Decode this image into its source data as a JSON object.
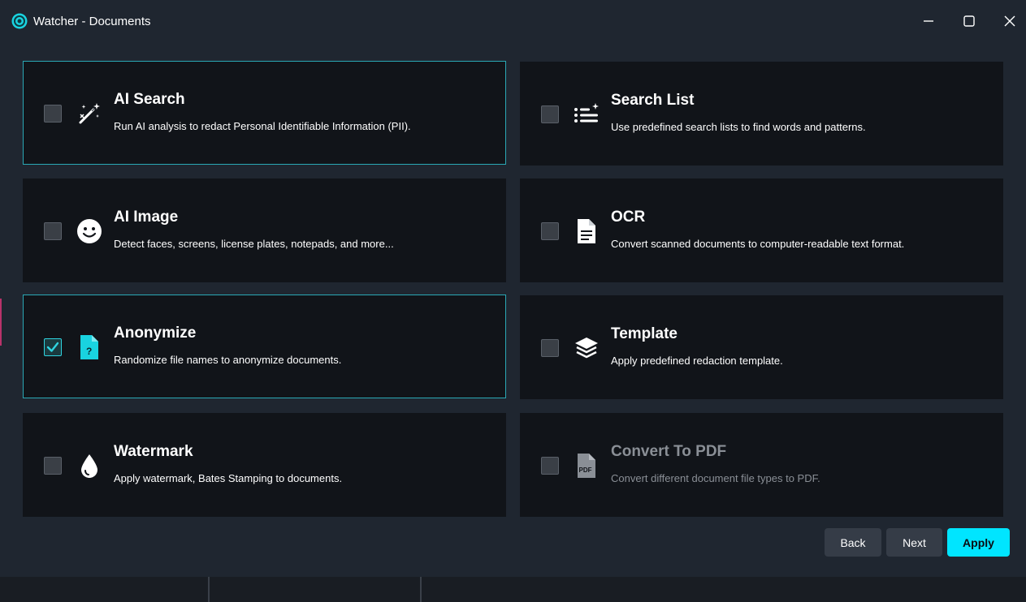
{
  "window": {
    "title": "Watcher - Documents",
    "accent_color": "#00e5ff"
  },
  "options": [
    {
      "title": "AI Search",
      "description": "Run AI analysis to redact Personal Identifiable Information (PII).",
      "icon": "magic-wand-icon",
      "checked": false
    },
    {
      "title": "Search List",
      "description": "Use predefined search lists to find words and patterns.",
      "icon": "list-sparkle-icon",
      "checked": false
    },
    {
      "title": "AI Image",
      "description": "Detect faces, screens, license plates, notepads, and more...",
      "icon": "smiley-face-icon",
      "checked": false
    },
    {
      "title": "OCR",
      "description": "Convert scanned documents to computer-readable text format.",
      "icon": "document-text-icon",
      "checked": false
    },
    {
      "title": "Anonymize",
      "description": "Randomize file names to anonymize documents.",
      "icon": "document-question-icon",
      "checked": true
    },
    {
      "title": "Template",
      "description": "Apply predefined redaction template.",
      "icon": "layers-icon",
      "checked": false
    },
    {
      "title": "Watermark",
      "description": "Apply watermark, Bates Stamping to documents.",
      "icon": "droplet-icon",
      "checked": false
    },
    {
      "title": "Convert To PDF",
      "description": "Convert different document file types to PDF.",
      "icon": "pdf-file-icon",
      "checked": false,
      "disabled": true
    }
  ],
  "buttons": {
    "back": "Back",
    "next": "Next",
    "apply": "Apply"
  }
}
